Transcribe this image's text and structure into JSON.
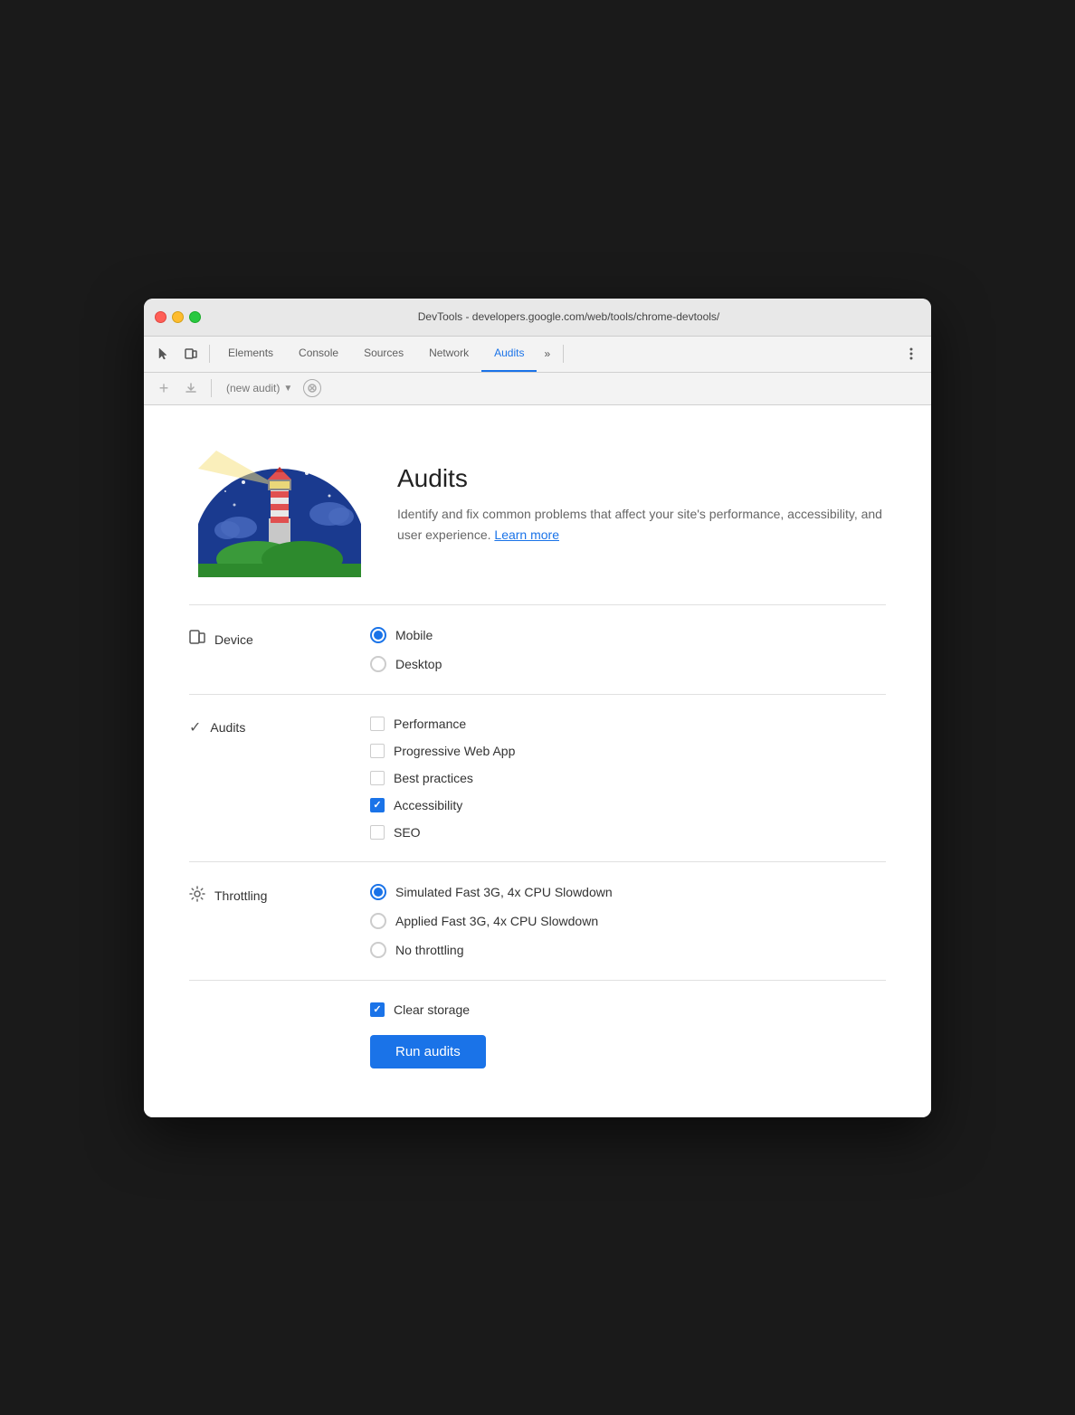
{
  "window": {
    "title": "DevTools - developers.google.com/web/tools/chrome-devtools/",
    "url": "DevTools - developers.google.com/web/tools/chrome-devtools/"
  },
  "tabs": [
    {
      "id": "elements",
      "label": "Elements",
      "active": false
    },
    {
      "id": "console",
      "label": "Console",
      "active": false
    },
    {
      "id": "sources",
      "label": "Sources",
      "active": false
    },
    {
      "id": "network",
      "label": "Network",
      "active": false
    },
    {
      "id": "audits",
      "label": "Audits",
      "active": true
    }
  ],
  "toolbar_more": "»",
  "secondary_toolbar": {
    "new_audit_label": "(new audit)",
    "stop_title": "Stop"
  },
  "hero": {
    "title": "Audits",
    "description": "Identify and fix common problems that affect your site's performance, accessibility, and user experience.",
    "learn_more": "Learn more"
  },
  "device_section": {
    "label": "Device",
    "options": [
      {
        "id": "mobile",
        "label": "Mobile",
        "checked": true
      },
      {
        "id": "desktop",
        "label": "Desktop",
        "checked": false
      }
    ]
  },
  "audits_section": {
    "label": "Audits",
    "options": [
      {
        "id": "performance",
        "label": "Performance",
        "checked": false
      },
      {
        "id": "pwa",
        "label": "Progressive Web App",
        "checked": false
      },
      {
        "id": "best-practices",
        "label": "Best practices",
        "checked": false
      },
      {
        "id": "accessibility",
        "label": "Accessibility",
        "checked": true
      },
      {
        "id": "seo",
        "label": "SEO",
        "checked": false
      }
    ]
  },
  "throttling_section": {
    "label": "Throttling",
    "options": [
      {
        "id": "simulated",
        "label": "Simulated Fast 3G, 4x CPU Slowdown",
        "checked": true
      },
      {
        "id": "applied",
        "label": "Applied Fast 3G, 4x CPU Slowdown",
        "checked": false
      },
      {
        "id": "no-throttling",
        "label": "No throttling",
        "checked": false
      }
    ]
  },
  "clear_storage": {
    "label": "Clear storage",
    "checked": true
  },
  "run_button": {
    "label": "Run audits"
  }
}
